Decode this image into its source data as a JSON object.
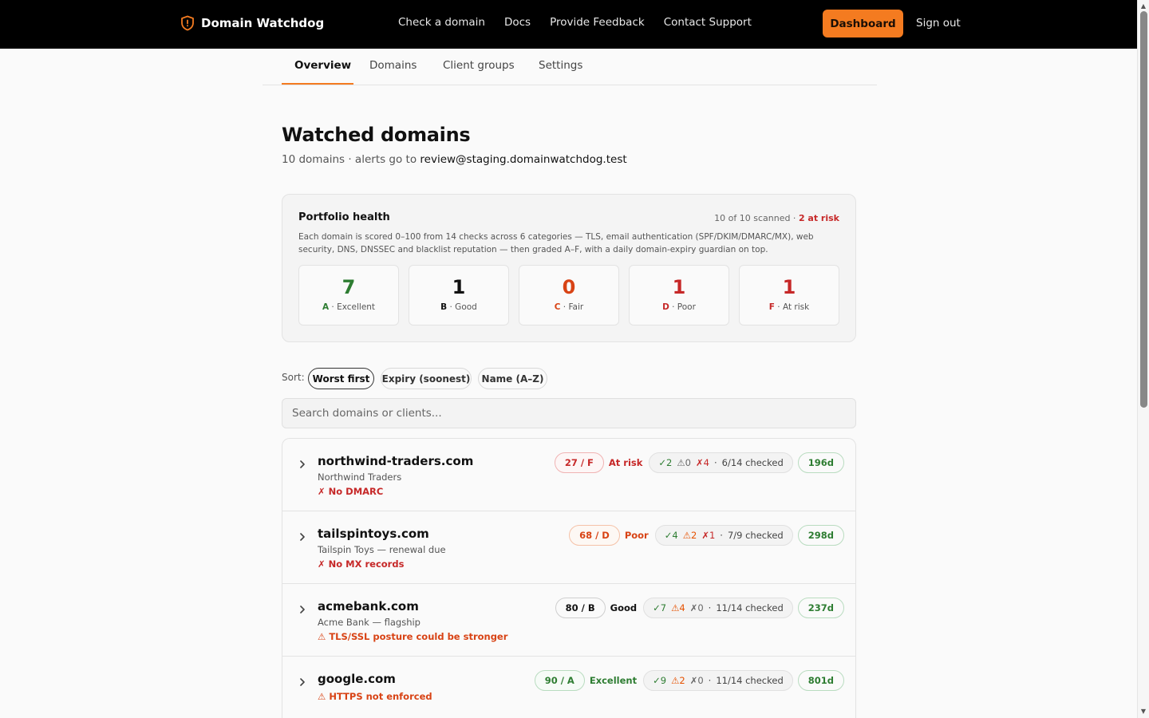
{
  "header": {
    "brand": "Domain Watchdog",
    "nav": [
      "Check a domain",
      "Docs",
      "Provide Feedback",
      "Contact Support"
    ],
    "dashboard_label": "Dashboard",
    "signout_label": "Sign out"
  },
  "tabs": [
    "Overview",
    "Domains",
    "Client groups",
    "Settings"
  ],
  "page": {
    "title": "Watched domains",
    "subtitle": "10 domains · alerts go to ",
    "alert_email": "review@staging.domainwatchdog.test"
  },
  "health": {
    "title": "Portfolio health",
    "scanned": "10 of 10 scanned · ",
    "at_risk": "2 at risk",
    "description": "Each domain is scored 0–100 from 14 checks across 6 categories — TLS, email authentication (SPF/DKIM/DMARC/MX), web security, DNS, DNSSEC and blacklist reputation — then graded A–F, with a daily domain-expiry guardian on top.",
    "grades": [
      {
        "count": "7",
        "letter": "A",
        "label": " · Excellent",
        "color": "#2e7d32"
      },
      {
        "count": "1",
        "letter": "B",
        "label": " · Good",
        "color": "#111111"
      },
      {
        "count": "0",
        "letter": "C",
        "label": " · Fair",
        "color": "#d84315"
      },
      {
        "count": "1",
        "letter": "D",
        "label": " · Poor",
        "color": "#c62828"
      },
      {
        "count": "1",
        "letter": "F",
        "label": " · At risk",
        "color": "#c62828"
      }
    ]
  },
  "sort": {
    "label": "Sort:",
    "options": [
      "Worst first",
      "Expiry (soonest)",
      "Name (A–Z)"
    ]
  },
  "search": {
    "placeholder": "Search domains or clients..."
  },
  "domains": [
    {
      "name": "northwind-traders.com",
      "client": "Northwind Traders",
      "issue": "✗ No DMARC",
      "issue_type": "bad",
      "score": "27 / F",
      "grade_word": "At risk",
      "ok": "✓2",
      "warn": "⚠0",
      "fail": "✗4",
      "checked": "6/14 checked",
      "expiry": "196d"
    },
    {
      "name": "tailspintoys.com",
      "client": "Tailspin Toys — renewal due",
      "issue": "✗ No MX records",
      "issue_type": "bad",
      "score": "68 / D",
      "grade_word": "Poor",
      "ok": "✓4",
      "warn": "⚠2",
      "fail": "✗1",
      "checked": "7/9 checked",
      "expiry": "298d"
    },
    {
      "name": "acmebank.com",
      "client": "Acme Bank — flagship",
      "issue": "⚠ TLS/SSL posture could be stronger",
      "issue_type": "warn",
      "score": "80 / B",
      "grade_word": "Good",
      "ok": "✓7",
      "warn": "⚠4",
      "fail": "✗0",
      "checked": "11/14 checked",
      "expiry": "237d"
    },
    {
      "name": "google.com",
      "client": "",
      "issue": "⚠ HTTPS not enforced",
      "issue_type": "warn",
      "score": "90 / A",
      "grade_word": "Excellent",
      "ok": "✓9",
      "warn": "⚠2",
      "fail": "✗0",
      "checked": "11/14 checked",
      "expiry": "801d"
    }
  ],
  "colors": {
    "accent": "#f47b20",
    "good": "#2e7d32",
    "bad": "#c62828",
    "warn": "#d84315"
  }
}
